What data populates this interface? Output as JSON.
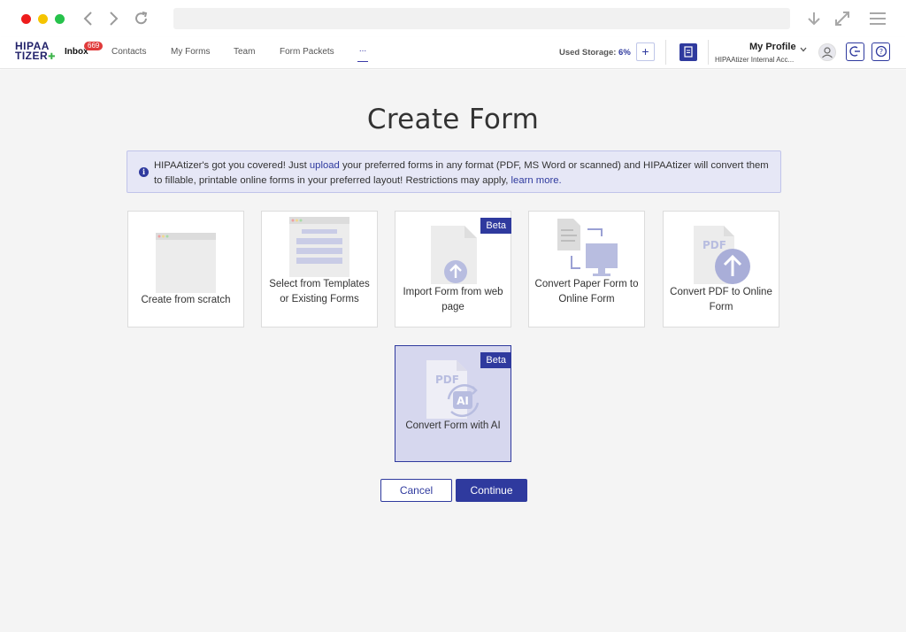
{
  "header": {
    "logo_line1": "HIPAA",
    "logo_line2": "TIZER",
    "nav": [
      {
        "label": "Inbox",
        "badge": "669"
      },
      {
        "label": "Contacts"
      },
      {
        "label": "My Forms"
      },
      {
        "label": "Team"
      },
      {
        "label": "Form Packets"
      }
    ],
    "more": "...",
    "storage_label": "Used Storage:",
    "storage_value": "6%",
    "add_label": "+",
    "profile_name": "My Profile",
    "profile_org": "HIPAAtizer Internal Acc...",
    "colors": {
      "brand": "#2f3a9e",
      "badge": "#e03a3a"
    }
  },
  "page": {
    "title": "Create Form",
    "info": {
      "icon": "info-icon",
      "part1": "HIPAAtizer's got you covered! Just ",
      "link1": "upload",
      "part2": " your preferred forms in any format (PDF, MS Word or scanned) and HIPAAtizer will convert them to fillable, printable online forms in your preferred layout! Restrictions may apply, ",
      "link2": "learn more."
    },
    "options": [
      {
        "label": "Create from scratch",
        "icon": "blank-window-icon"
      },
      {
        "label": "Select from Templates or Existing Forms",
        "icon": "template-icon"
      },
      {
        "label": "Import Form from web page",
        "icon": "import-upload-icon",
        "badge": "Beta"
      },
      {
        "label": "Convert Paper Form to Online Form",
        "icon": "paper-to-screen-icon"
      },
      {
        "label": "Convert PDF to Online Form",
        "icon": "pdf-upload-icon"
      },
      {
        "label": "Convert Form with AI",
        "icon": "pdf-ai-icon",
        "badge": "Beta",
        "selected": true
      }
    ],
    "cancel_label": "Cancel",
    "continue_label": "Continue"
  }
}
